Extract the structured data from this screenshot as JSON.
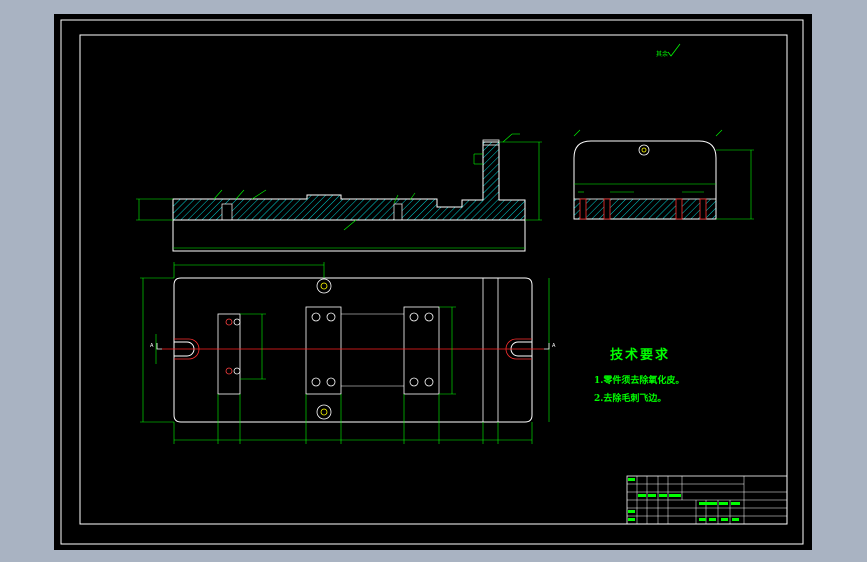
{
  "colors": {
    "background": "#000000",
    "frame": "#ffffff",
    "dimension": "#00ff00",
    "centerline": "#ff2020",
    "hatch": "#00ffff",
    "hole_center": "#ff0000",
    "hole_core": "#ffff00",
    "outer_margin": "#a9b3c2"
  },
  "roughness_note": "其余",
  "technical_requirements": {
    "title": "技术要求",
    "items": [
      "1.零件须去除氧化皮。",
      "2.去除毛刺飞边。"
    ]
  },
  "section_marks": {
    "left": "A",
    "right": "A"
  }
}
